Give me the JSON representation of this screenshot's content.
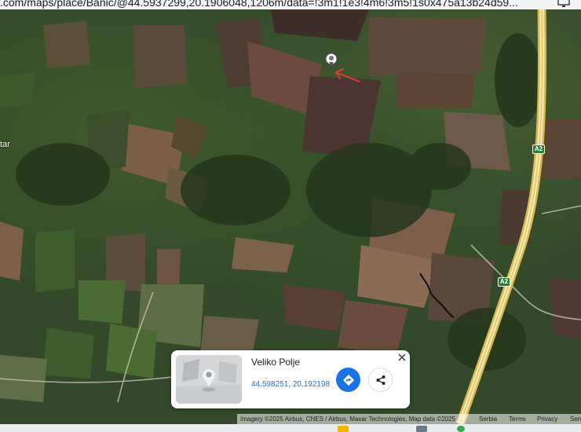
{
  "browser": {
    "url": ".com/maps/place/Banić/@44.5937299,20.1906048,1206m/data=!3m1!1e3!4m6!3m5!1s0x475a13b24d59...",
    "extension_icon": "monitor-icon"
  },
  "map": {
    "partial_place_label": "tar",
    "highway_shields": [
      {
        "text": "A2"
      },
      {
        "text": "A2"
      }
    ],
    "pin_icon": "location-pin-icon",
    "annotation_arrow_color": "#e53935",
    "annotation_line_color": "#111111"
  },
  "place_card": {
    "title": "Veliko Polje",
    "coordinates": "44.598251, 20.192198",
    "thumbnail_icon": "street-view-placeholder-icon",
    "directions_icon": "directions-icon",
    "share_icon": "share-icon",
    "close_icon": "close-icon",
    "accent": "#1a73e8"
  },
  "attribution": {
    "imagery": "Imagery ©2025 Airbus, CNES / Airbus, Maxar Technologies, Map data ©2025",
    "country": "Serbia",
    "terms": "Terms",
    "privacy": "Privacy",
    "send_feedback": "Sen"
  },
  "taskbar": {
    "icons": [
      "file-explorer-icon",
      "app-icon",
      "chrome-icon"
    ]
  }
}
